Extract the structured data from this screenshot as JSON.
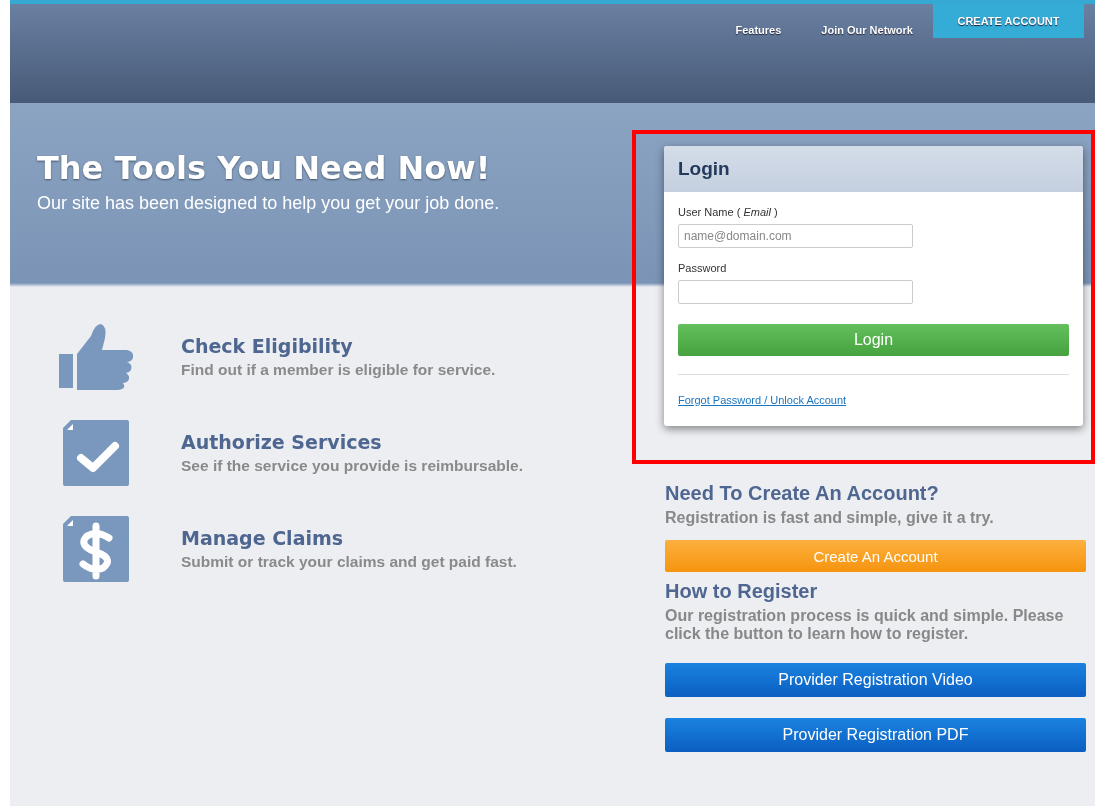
{
  "nav": [
    {
      "label": "Features",
      "kind": "link"
    },
    {
      "label": "Join Our Network",
      "kind": "link"
    },
    {
      "label": "CREATE ACCOUNT",
      "kind": "button"
    }
  ],
  "hero": {
    "title": "The Tools You Need Now!",
    "subtitle": "Our site has been designed to help you get your job done."
  },
  "features": [
    {
      "kind": "thumbs-up",
      "title": "Check Eligibility",
      "text": "Find out if a member is eligible for service."
    },
    {
      "kind": "check",
      "title": "Authorize Services",
      "text": "See if the service you provide is reimbursable."
    },
    {
      "kind": "dollar",
      "title": "Manage Claims",
      "text": "Submit or track your claims and get paid fast."
    }
  ],
  "login": {
    "title": "Login",
    "username_label": "User Name  ( *Email* )",
    "username_placeholder": "name@domain.com",
    "password_label": "Password",
    "button": "Login",
    "forgot_link": "Forgot Password / Unlock Account"
  },
  "create": {
    "title": "Need To Create An Account?",
    "text": "Registration is fast and simple, give it a try.",
    "button": "Create An Account"
  },
  "register": {
    "title": "How to Register",
    "text": "Our registration process is quick and simple. Please click the button to learn how to register.",
    "buttons": [
      "Provider Registration Video",
      "Provider Registration PDF"
    ]
  }
}
